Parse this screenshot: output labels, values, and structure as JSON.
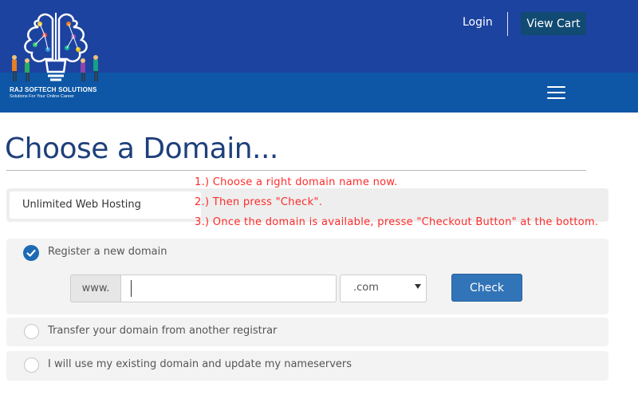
{
  "header": {
    "brand_name": "RAJ SOFTECH SOLUTIONS",
    "brand_tagline": "Solutions For Your Online Career",
    "login_label": "Login",
    "view_cart_label": "View Cart",
    "colors": {
      "top_bar": "#1d43a0",
      "nav_bar": "#0d57a6",
      "cart_button": "#114a72"
    }
  },
  "main": {
    "page_title": "Choose a Domain...",
    "product_name": "Unlimited Web Hosting",
    "instructions": [
      "1.) Choose a right domain name now.",
      "2.) Then press \"Check\".",
      "3.) Once the domain is available, presse \"Checkout Button\" at the bottom."
    ],
    "options": {
      "register": {
        "label": "Register a new domain",
        "selected": true
      },
      "transfer": {
        "label": "Transfer your domain from another registrar",
        "selected": false
      },
      "existing": {
        "label": "I will use my existing domain and update my nameservers",
        "selected": false
      }
    },
    "domain_search": {
      "prefix": "www.",
      "value": "",
      "tld": ".com",
      "check_label": "Check"
    },
    "colors": {
      "title": "#1e3f7b",
      "instructions": "#ff2a2a",
      "check_button": "#3274b8",
      "radio_selected": "#1d6ab4"
    }
  }
}
